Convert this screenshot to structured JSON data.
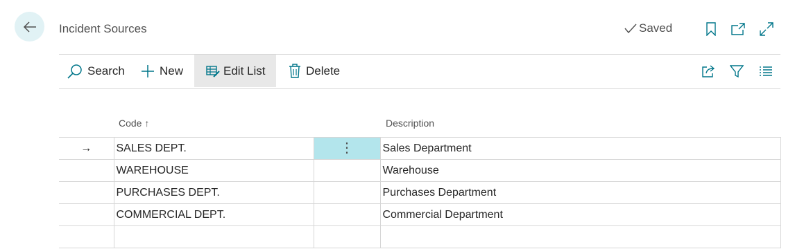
{
  "header": {
    "title": "Incident Sources",
    "saved_label": "Saved",
    "icons": [
      "back-arrow-icon",
      "checkmark-icon",
      "bookmark-icon",
      "open-in-new-window-icon",
      "expand-icon"
    ]
  },
  "toolbar": {
    "search_label": "Search",
    "new_label": "New",
    "edit_list_label": "Edit List",
    "delete_label": "Delete",
    "icons": [
      "search-icon",
      "plus-icon",
      "edit-list-icon",
      "trash-icon",
      "share-icon",
      "filter-icon",
      "list-view-icon"
    ]
  },
  "table": {
    "columns": {
      "code": "Code",
      "sort_indicator": "↑",
      "description": "Description"
    },
    "rows": [
      {
        "code": "SALES DEPT.",
        "description": "Sales Department",
        "selected": true,
        "row_marker": "→",
        "menu": "⋮"
      },
      {
        "code": "WAREHOUSE",
        "description": "Warehouse"
      },
      {
        "code": "PURCHASES DEPT.",
        "description": "Purchases Department"
      },
      {
        "code": "COMMERCIAL DEPT.",
        "description": "Commercial Department"
      },
      {
        "code": "",
        "description": ""
      }
    ]
  },
  "colors": {
    "accent_bg": "#e1f2f5",
    "selected_cell": "#b3e5ec",
    "link": "#00768a"
  }
}
